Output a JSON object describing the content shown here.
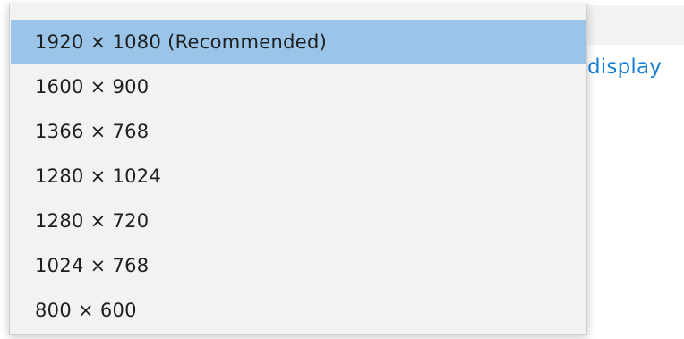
{
  "background": {
    "link_text": "display"
  },
  "dropdown": {
    "selected_index": 0,
    "accent_color": "#9ac4e8",
    "options": [
      {
        "label": "1920 × 1080 (Recommended)"
      },
      {
        "label": "1600 × 900"
      },
      {
        "label": "1366 × 768"
      },
      {
        "label": "1280 × 1024"
      },
      {
        "label": "1280 × 720"
      },
      {
        "label": "1024 × 768"
      },
      {
        "label": "800 × 600"
      }
    ]
  }
}
